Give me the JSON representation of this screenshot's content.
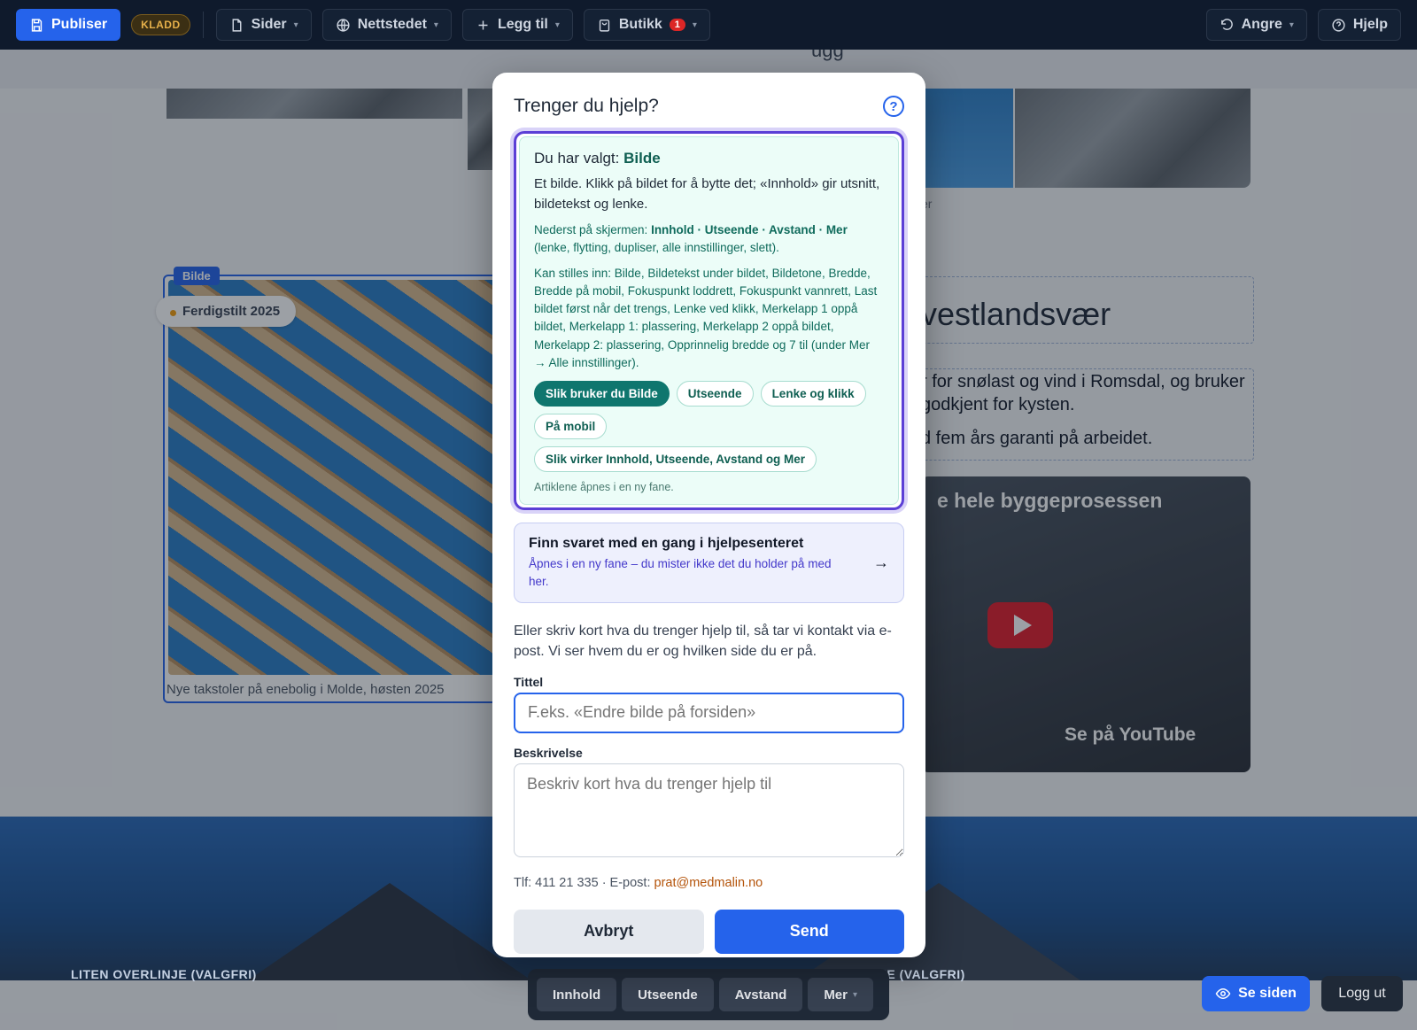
{
  "topbar": {
    "publish_label": "Publiser",
    "draft_badge": "KLADD",
    "pages_label": "Sider",
    "site_label": "Nettstedet",
    "add_label": "Legg til",
    "shop_label": "Butikk",
    "shop_count": "1",
    "undo_label": "Angre",
    "help_label": "Hjelp"
  },
  "background": {
    "image_tag": "Bilde",
    "status_pill": "Ferdigstilt 2025",
    "image_caption": "Nye takstoler på enebolig i Molde, høsten 2025",
    "caption_tail": "er",
    "heading_fragment": "vestlandsvær",
    "para_line1": "r for snølast og vind i Romsdal, og bruker",
    "para_line2": "godkjent for kysten.",
    "para_line3": "d fem års garanti på arbeidet.",
    "video_title": "e hele byggeprosessen",
    "video_watch": "Se på",
    "video_brand": "YouTube",
    "overline_left": "LITEN OVERLINJE (VALGFRI)",
    "overline_right": "LITEN OVERLINJE (VALGFRI)",
    "top_fragment": "ugg"
  },
  "bottom_toolbar": {
    "content": "Innhold",
    "appearance": "Utseende",
    "spacing": "Avstand",
    "more": "Mer"
  },
  "se_siden_label": "Se siden",
  "logg_ut_label": "Logg ut",
  "modal": {
    "title": "Trenger du hjelp?",
    "selection": {
      "prefix": "Du har valgt: ",
      "name": "Bilde",
      "description": "Et bilde. Klikk på bildet for å bytte det; «Innhold» gir utsnitt, bildetekst og lenke.",
      "bottom_prefix": "Nederst på skjermen: ",
      "bottom_items": "Innhold · Utseende · Avstand · Mer",
      "bottom_suffix": " (lenke, flytting, dupliser, alle innstillinger, slett).",
      "settings": "Kan stilles inn: Bilde, Bildetekst under bildet, Bildetone, Bredde, Bredde på mobil, Fokuspunkt loddrett, Fokuspunkt vannrett, Last bildet først når det trengs, Lenke ved klikk, Merkelapp 1 oppå bildet, Merkelapp 1: plassering, Merkelapp 2 oppå bildet, Merkelapp 2: plassering, Opprinnelig bredde og 7 til (under Mer → Alle innstillinger).",
      "chips": [
        "Slik bruker du Bilde",
        "Utseende",
        "Lenke og klikk",
        "På mobil",
        "Slik virker Innhold, Utseende, Avstand og Mer"
      ],
      "note": "Artiklene åpnes i en ny fane."
    },
    "helpcenter": {
      "title": "Finn svaret med en gang i hjelpesenteret",
      "subtitle": "Åpnes i en ny fane – du mister ikke det du holder på med her.",
      "arrow": "→"
    },
    "intro": "Eller skriv kort hva du trenger hjelp til, så tar vi kontakt via e-post. Vi ser hvem du er og hvilken side du er på.",
    "title_label": "Tittel",
    "title_placeholder": "F.eks. «Endre bilde på forsiden»",
    "desc_label": "Beskrivelse",
    "desc_placeholder": "Beskriv kort hva du trenger hjelp til",
    "contact_prefix": "Tlf: 411 21 335 · E-post: ",
    "contact_email": "prat@medmalin.no",
    "cancel_label": "Avbryt",
    "send_label": "Send"
  },
  "colors": {
    "accent": "#2563eb",
    "selection_border": "#5b3fd6",
    "selection_bg": "#ecfdf8",
    "teal": "#0f766e",
    "topbar": "#0f1a2c"
  }
}
